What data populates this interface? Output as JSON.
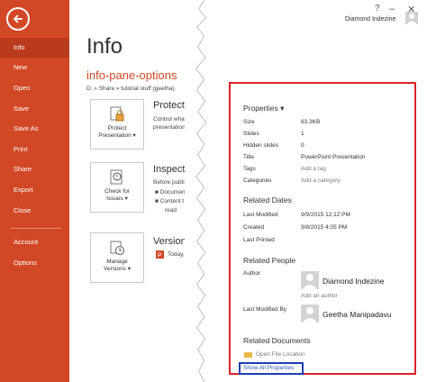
{
  "nav": {
    "items": [
      {
        "label": "Info",
        "active": true
      },
      {
        "label": "New"
      },
      {
        "label": "Open"
      },
      {
        "label": "Save"
      },
      {
        "label": "Save As"
      },
      {
        "label": "Print"
      },
      {
        "label": "Share"
      },
      {
        "label": "Export"
      },
      {
        "label": "Close"
      },
      {
        "label": "Account"
      },
      {
        "label": "Options"
      }
    ]
  },
  "header": {
    "help": "?",
    "min": "–",
    "close": "✕",
    "account_name": "Diamond Indezine"
  },
  "main": {
    "title": "Info",
    "doc_title": "info-pane-options",
    "doc_path": "D: » Share » tutorial stuff (geetha)",
    "sections": [
      {
        "tile_label_1": "Protect",
        "tile_label_2": "Presentation ▾",
        "heading": "Protect P",
        "text": "Control what t presentation."
      },
      {
        "tile_label_1": "Check for",
        "tile_label_2": "Issues ▾",
        "heading": "Inspect Pr",
        "text": "Before publishin",
        "bullets": [
          "■  Documen",
          "■  Content t",
          "read"
        ]
      },
      {
        "tile_label_1": "Manage",
        "tile_label_2": "Versions ▾",
        "heading": "Versions",
        "text": "Today, 2:4"
      }
    ]
  },
  "properties": {
    "heading": "Properties ▾",
    "rows": [
      {
        "label": "Size",
        "value": "63.3KB",
        "muted": false
      },
      {
        "label": "Slides",
        "value": "1",
        "muted": false
      },
      {
        "label": "Hidden slides",
        "value": "0",
        "muted": false
      },
      {
        "label": "Title",
        "value": "PowerPoint Presentation",
        "muted": false
      },
      {
        "label": "Tags",
        "value": "Add a tag",
        "muted": true
      },
      {
        "label": "Categories",
        "value": "Add a category",
        "muted": true
      }
    ],
    "dates_heading": "Related Dates",
    "dates": [
      {
        "label": "Last Modified",
        "value": "9/9/2015 12:12 PM"
      },
      {
        "label": "Created",
        "value": "9/8/2015 4:05 PM"
      },
      {
        "label": "Last Printed",
        "value": ""
      }
    ],
    "people_heading": "Related People",
    "author_label": "Author",
    "author_name": "Diamond Indezine",
    "add_author": "Add an author",
    "last_modified_by_label": "Last Modified By",
    "last_modified_by_name": "Geetha Manipadavu",
    "docs_heading": "Related Documents",
    "open_file_location": "Open File Location",
    "show_all": "Show All Properties"
  }
}
